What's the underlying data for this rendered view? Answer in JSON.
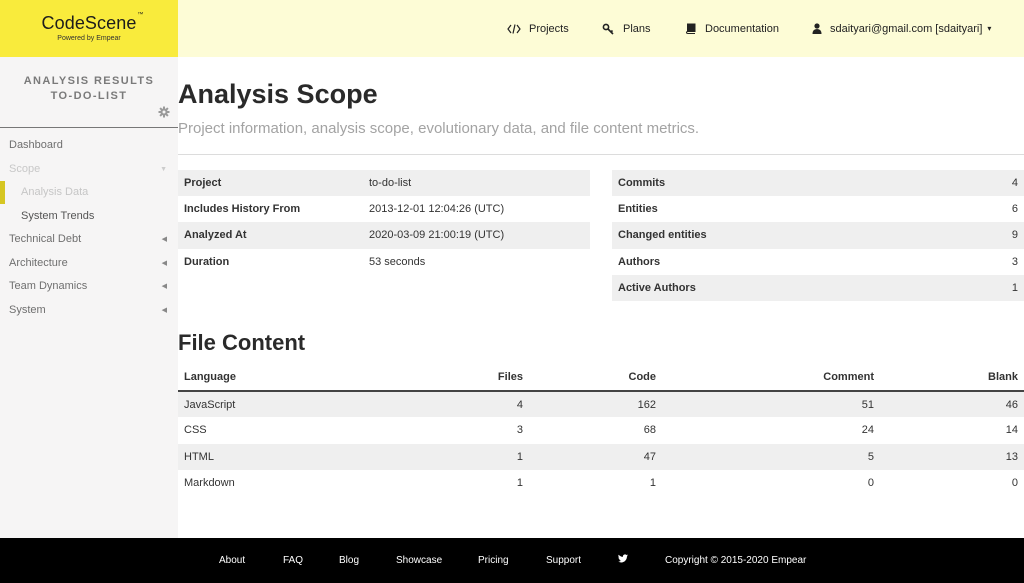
{
  "brand": {
    "name": "CodeScene",
    "trademark": "™",
    "tagline": "Powered by Empear",
    "color": "#f9eb3c"
  },
  "topnav": {
    "items": [
      {
        "icon": "code-icon",
        "label": "Projects"
      },
      {
        "icon": "key-icon",
        "label": "Plans"
      },
      {
        "icon": "book-icon",
        "label": "Documentation"
      }
    ],
    "user": {
      "icon": "user-icon",
      "label": "sdaityari@gmail.com [sdaityari]",
      "caret": "▾"
    }
  },
  "sidebar": {
    "title_line1": "ANALYSIS RESULTS",
    "title_line2": "TO-DO-LIST",
    "settings_icon": "gear-icon",
    "menu": [
      {
        "label": "Dashboard",
        "arrow": ""
      },
      {
        "label": "Scope",
        "arrow": "▼"
      },
      {
        "label": "Analysis Data",
        "sub": true,
        "active": true
      },
      {
        "label": "System Trends",
        "sub": true
      },
      {
        "label": "Technical Debt",
        "arrow": "◀"
      },
      {
        "label": "Architecture",
        "arrow": "◀"
      },
      {
        "label": "Team Dynamics",
        "arrow": "◀"
      },
      {
        "label": "System",
        "arrow": "◀"
      }
    ]
  },
  "page": {
    "title": "Analysis Scope",
    "subtitle": "Project information, analysis scope, evolutionary data, and file content metrics."
  },
  "project_info": [
    {
      "key": "Project",
      "value": "to-do-list"
    },
    {
      "key": "Includes History From",
      "value": "2013-12-01 12:04:26 (UTC)"
    },
    {
      "key": "Analyzed At",
      "value": "2020-03-09 21:00:19 (UTC)"
    },
    {
      "key": "Duration",
      "value": "53 seconds"
    }
  ],
  "evolution_stats": [
    {
      "key": "Commits",
      "value": "4"
    },
    {
      "key": "Entities",
      "value": "6"
    },
    {
      "key": "Changed entities",
      "value": "9"
    },
    {
      "key": "Authors",
      "value": "3"
    },
    {
      "key": "Active Authors",
      "value": "1"
    }
  ],
  "file_content": {
    "title": "File Content",
    "columns": [
      "Language",
      "Files",
      "Code",
      "Comment",
      "Blank"
    ],
    "rows": [
      [
        "JavaScript",
        "4",
        "162",
        "51",
        "46"
      ],
      [
        "CSS",
        "3",
        "68",
        "24",
        "14"
      ],
      [
        "HTML",
        "1",
        "47",
        "5",
        "13"
      ],
      [
        "Markdown",
        "1",
        "1",
        "0",
        "0"
      ]
    ]
  },
  "footer": {
    "links": [
      "About",
      "FAQ",
      "Blog",
      "Showcase",
      "Pricing",
      "Support"
    ],
    "social_icon": "twitter-icon",
    "copyright": "Copyright © 2015-2020 Empear"
  }
}
